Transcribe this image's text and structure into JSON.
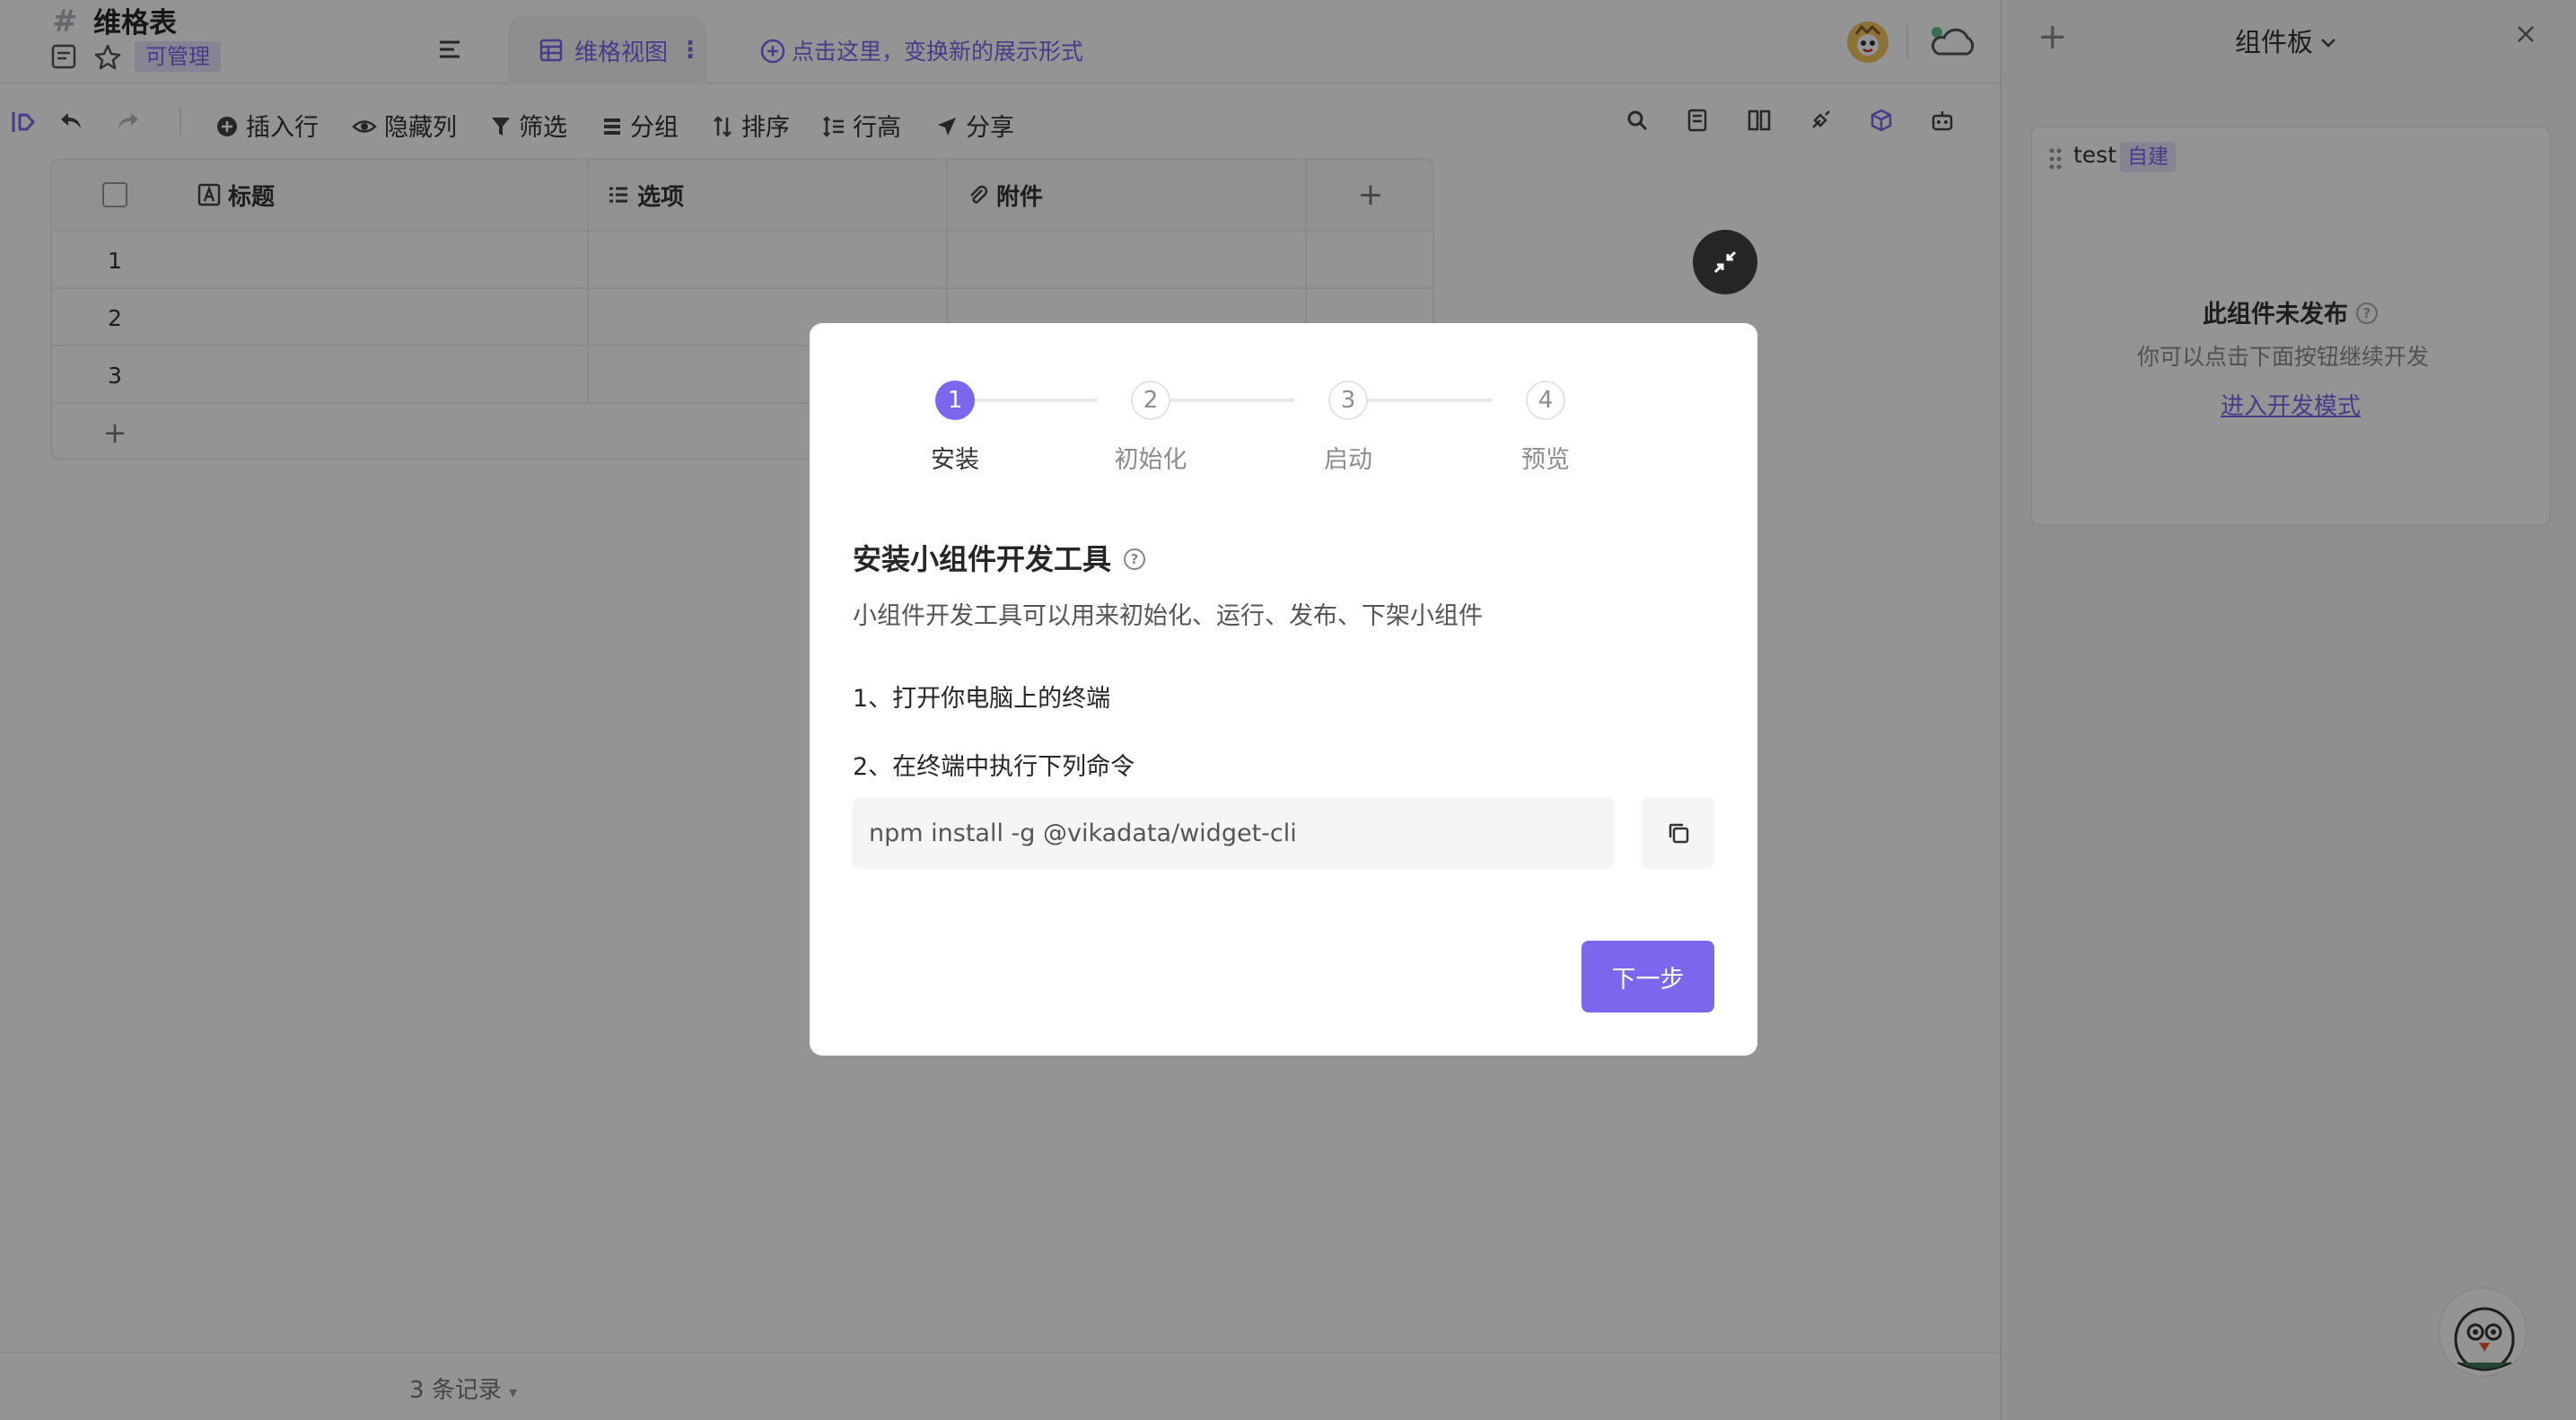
{
  "header": {
    "sheet_title": "维格表",
    "permission_badge": "可管理",
    "view_tab": "维格视图",
    "add_view_hint": "点击这里，变换新的展示形式"
  },
  "toolbar": {
    "insert_row": "插入行",
    "hide_columns": "隐藏列",
    "filter": "筛选",
    "group": "分组",
    "sort": "排序",
    "row_height": "行高",
    "share": "分享"
  },
  "grid": {
    "columns": [
      {
        "name": "标题",
        "icon": "text-field-icon"
      },
      {
        "name": "选项",
        "icon": "options-field-icon"
      },
      {
        "name": "附件",
        "icon": "attachment-field-icon"
      }
    ],
    "rows": [
      "1",
      "2",
      "3"
    ]
  },
  "footer": {
    "record_count": "3 条记录"
  },
  "panel": {
    "title": "组件板",
    "widget_name": "test",
    "widget_badge": "自建",
    "unpublished_title": "此组件未发布",
    "unpublished_desc": "你可以点击下面按钮继续开发",
    "dev_mode_link": "进入开发模式"
  },
  "modal": {
    "steps": [
      {
        "num": "1",
        "label": "安装"
      },
      {
        "num": "2",
        "label": "初始化"
      },
      {
        "num": "3",
        "label": "启动"
      },
      {
        "num": "4",
        "label": "预览"
      }
    ],
    "active_step": 1,
    "title": "安装小组件开发工具",
    "description": "小组件开发工具可以用来初始化、运行、发布、下架小组件",
    "step1": "1、打开你电脑上的终端",
    "step2": "2、在终端中执行下列命令",
    "command": "npm install -g @vikadata/widget-cli",
    "next_button": "下一步"
  },
  "colors": {
    "accent": "#7b67ee",
    "overlay": "rgba(0,0,0,0.42)"
  }
}
